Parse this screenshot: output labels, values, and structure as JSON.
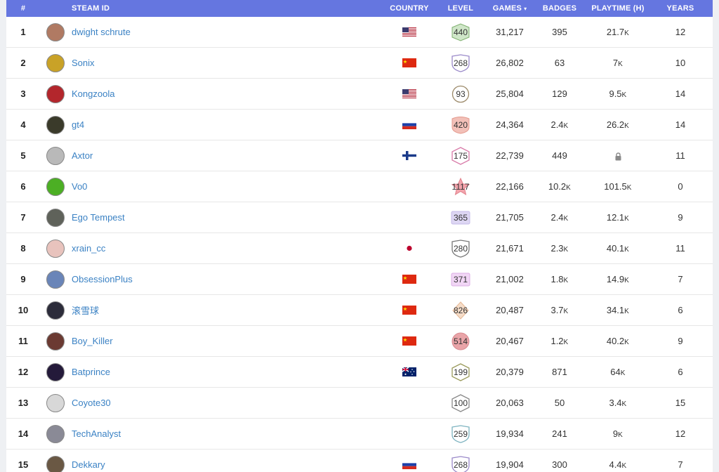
{
  "table": {
    "headers": {
      "rank": "#",
      "steam_id": "STEAM ID",
      "country": "COUNTRY",
      "level": "LEVEL",
      "games": "GAMES",
      "badges": "BADGES",
      "playtime": "PLAYTIME (H)",
      "years": "YEARS"
    },
    "sort_indicator": "▾",
    "rows": [
      {
        "rank": "1",
        "name": "dwight schrute",
        "country": "us",
        "level": "440",
        "games": "31,217",
        "badges": "395",
        "playtime": "21.7",
        "playtime_unit": "K",
        "years": "12",
        "avatar": "#b07a63",
        "level_style": "shield-green"
      },
      {
        "rank": "2",
        "name": "Sonix",
        "country": "cn",
        "level": "268",
        "games": "26,802",
        "badges": "63",
        "playtime": "7",
        "playtime_unit": "K",
        "years": "10",
        "avatar": "#c9a227",
        "level_style": "shield-purple"
      },
      {
        "rank": "3",
        "name": "Kongzoola",
        "country": "us",
        "level": "93",
        "games": "25,804",
        "badges": "129",
        "playtime": "9.5",
        "playtime_unit": "K",
        "years": "14",
        "avatar": "#b3262c",
        "level_style": "circle"
      },
      {
        "rank": "4",
        "name": "gt4",
        "country": "ru",
        "level": "420",
        "games": "24,364",
        "badges": "2.4",
        "badges_unit": "K",
        "playtime": "26.2",
        "playtime_unit": "K",
        "years": "14",
        "avatar": "#3a3a2a",
        "level_style": "shield-red"
      },
      {
        "rank": "5",
        "name": "Axtor",
        "country": "fi",
        "level": "175",
        "games": "22,739",
        "badges": "449",
        "playtime": "",
        "playtime_locked": true,
        "years": "11",
        "avatar": "#b9b9b9",
        "level_style": "hex-pink"
      },
      {
        "rank": "6",
        "name": "Vo0",
        "country": "",
        "level": "1117",
        "games": "22,166",
        "badges": "10.2",
        "badges_unit": "K",
        "playtime": "101.5",
        "playtime_unit": "K",
        "years": "0",
        "avatar": "#4caf24",
        "level_style": "star"
      },
      {
        "rank": "7",
        "name": "Ego Tempest",
        "country": "",
        "level": "365",
        "games": "21,705",
        "badges": "2.4",
        "badges_unit": "K",
        "playtime": "12.1",
        "playtime_unit": "K",
        "years": "9",
        "avatar": "#5f625a",
        "level_style": "rect-lavender"
      },
      {
        "rank": "8",
        "name": "xrain_cc",
        "country": "jp",
        "level": "280",
        "games": "21,671",
        "badges": "2.3",
        "badges_unit": "K",
        "playtime": "40.1",
        "playtime_unit": "K",
        "years": "11",
        "avatar": "#e8c3bd",
        "level_style": "shield-gray"
      },
      {
        "rank": "9",
        "name": "ObsessionPlus",
        "country": "cn",
        "level": "371",
        "games": "21,002",
        "badges": "1.8",
        "badges_unit": "K",
        "playtime": "14.9",
        "playtime_unit": "K",
        "years": "7",
        "avatar": "#6a85b8",
        "level_style": "rect-violet"
      },
      {
        "rank": "10",
        "name": "滚雪球",
        "country": "cn",
        "level": "826",
        "games": "20,487",
        "badges": "3.7",
        "badges_unit": "K",
        "playtime": "34.1",
        "playtime_unit": "K",
        "years": "6",
        "avatar": "#2c2c3a",
        "level_style": "diamond"
      },
      {
        "rank": "11",
        "name": "Boy_Killer",
        "country": "cn",
        "level": "514",
        "games": "20,467",
        "badges": "1.2",
        "badges_unit": "K",
        "playtime": "40.2",
        "playtime_unit": "K",
        "years": "9",
        "avatar": "#6b3a32",
        "level_style": "circle-red"
      },
      {
        "rank": "12",
        "name": "Batprince",
        "country": "au",
        "level": "199",
        "games": "20,379",
        "badges": "871",
        "playtime": "64",
        "playtime_unit": "K",
        "years": "6",
        "avatar": "#241a3a",
        "level_style": "hex-olive"
      },
      {
        "rank": "13",
        "name": "Coyote30",
        "country": "",
        "level": "100",
        "games": "20,063",
        "badges": "50",
        "playtime": "3.4",
        "playtime_unit": "K",
        "years": "15",
        "avatar": "#d8d8d8",
        "level_style": "hex-gray"
      },
      {
        "rank": "14",
        "name": "TechAnalyst",
        "country": "",
        "level": "259",
        "games": "19,934",
        "badges": "241",
        "playtime": "9",
        "playtime_unit": "K",
        "years": "12",
        "avatar": "#8a8a96",
        "level_style": "shield-teal"
      },
      {
        "rank": "15",
        "name": "Dekkary",
        "country": "ru",
        "level": "268",
        "games": "19,904",
        "badges": "300",
        "playtime": "4.4",
        "playtime_unit": "K",
        "years": "7",
        "avatar": "#6a5844",
        "level_style": "shield-purple"
      }
    ]
  },
  "colors": {
    "header_bg": "#6576e0",
    "link": "#3b82c4"
  }
}
